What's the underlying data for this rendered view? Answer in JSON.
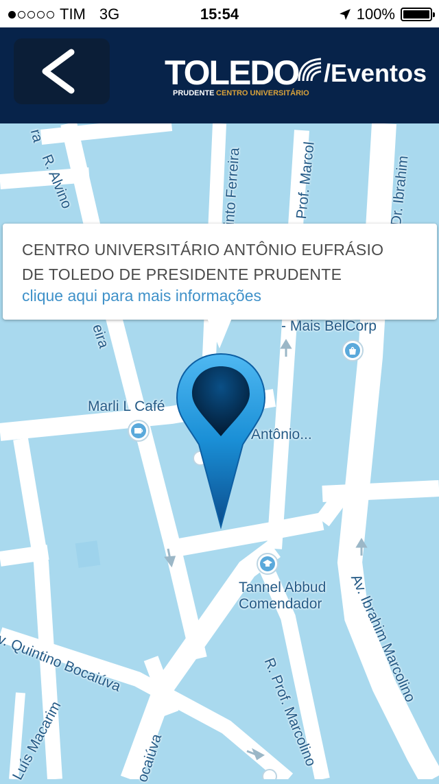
{
  "status_bar": {
    "carrier": "TIM",
    "network": "3G",
    "time": "15:54",
    "battery": "100%",
    "signal_bars": 1,
    "battery_level": 1.0
  },
  "header": {
    "logo_main": "TOLEDO",
    "logo_section": "/Eventos",
    "logo_sub_left": "PRUDENTE",
    "logo_sub_right": "CENTRO UNIVERSITÁRIO",
    "background_color": "#07234a",
    "back_icon": "chevron-left-icon"
  },
  "map": {
    "background_color": "#a9d9ee",
    "labels": {
      "belcorp": "- Mais BelCorp",
      "cafe": "Marli L Café",
      "partial_poi": "Antônio...",
      "school": "Tannel Abbud\nComendador"
    },
    "streets": {
      "alvino": "R. Alvino",
      "ferreira_top": "cinto Ferreira",
      "marcol_top": "Prof. Marcol",
      "ibrahim_top": "Dr. Ibrahim",
      "quintino": "v. Quintino Bocaiúva",
      "luis": "Luís Macarim",
      "bocaiuva": "ocaiúva",
      "marcolino_bottom": "R. Prof. Marcolino",
      "av_ibrahim": "Av. Ibrahim Marcolino",
      "ferreira_mid": "eira",
      "ra": "ra"
    }
  },
  "callout": {
    "title": "CENTRO UNIVERSITÁRIO ANTÔNIO EUFRÁSIO DE TOLEDO DE PRESIDENTE PRUDENTE",
    "link": "clique aqui para mais informações"
  },
  "pin": {
    "color": "#1a8fd6"
  }
}
